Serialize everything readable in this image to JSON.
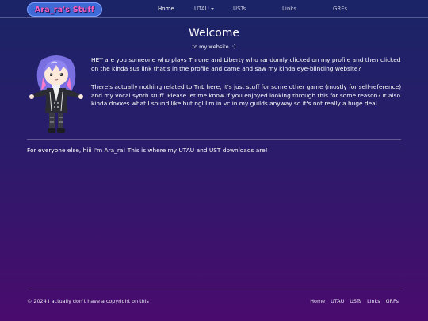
{
  "nav": {
    "logo_text": "Ara_ra's Stuff",
    "items": [
      {
        "label": "Home"
      },
      {
        "label": "UTAU"
      },
      {
        "label": "USTs"
      },
      {
        "label": "Links"
      },
      {
        "label": "GRFs"
      }
    ]
  },
  "main": {
    "title": "Welcome",
    "subtitle": "to my website. :)",
    "paragraph1": "HEY are you someone who plays Throne and Liberty who randomly clicked on my profile and then clicked on the kinda sus link that's in the profile and came and saw my kinda eye-blinding website?",
    "paragraph2": "There's actually nothing related to TnL here, it's just stuff for some other game (mostly for self-reference) and my vocal synth stuff. Please let me know if you enjoyed looking through this for some reason? It also kinda doxxes what I sound like but ngl I'm in vc in my guilds anyway so it's not really a huge deal.",
    "intro": "For everyone else, hiii I'm Ara_ra! This is where my UTAU and UST downloads are!"
  },
  "footer": {
    "copyright": "© 2024 I actually don't have a copyright on this",
    "links": [
      {
        "label": "Home"
      },
      {
        "label": "UTAU"
      },
      {
        "label": "USTs"
      },
      {
        "label": "Links"
      },
      {
        "label": "GRFs"
      }
    ]
  },
  "colors": {
    "bg_top": "#1a2466",
    "bg_bottom": "#4a0b6e",
    "logo_bg": "#3f6bd8",
    "logo_text": "#ff5fc0"
  }
}
